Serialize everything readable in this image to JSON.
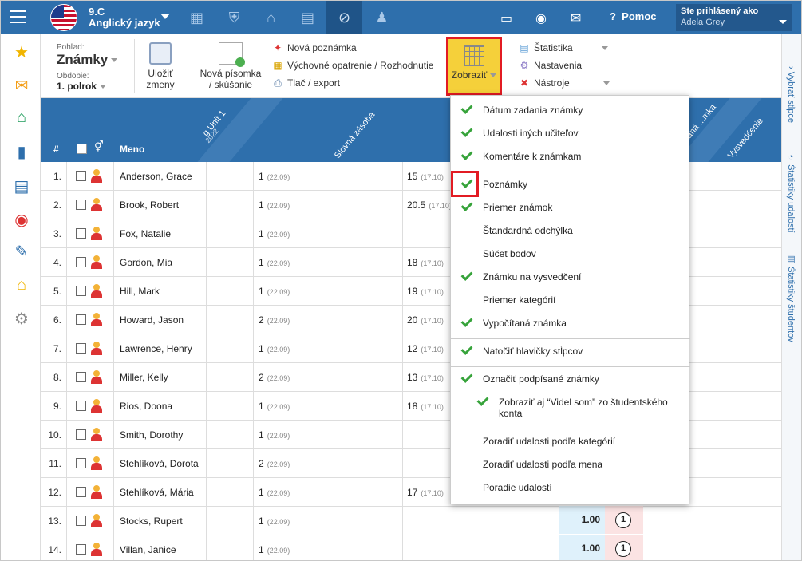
{
  "topbar": {
    "class_name": "9.C",
    "subject": "Anglický jazyk",
    "help": "Pomoc",
    "user_label": "Ste prihlásený ako",
    "user_name": "Adela Grey"
  },
  "toolbar": {
    "view_label": "Pohľad:",
    "view_value": "Známky",
    "period_label": "Obdobie:",
    "period_value": "1. polrok",
    "save_line1": "Uložiť",
    "save_line2": "zmeny",
    "new_test_line1": "Nová písomka",
    "new_test_line2": "/ skúšanie",
    "new_note": "Nová poznámka",
    "edu_measure": "Výchovné opatrenie / Rozhodnutie",
    "print": "Tlač / export",
    "display": "Zobraziť",
    "stats": "Štatistika",
    "settings": "Nastavenia",
    "tools": "Nástroje"
  },
  "right_sidebar": {
    "pick_columns": "Vybrať stĺpce",
    "event_stats": "Štatistiky udalostí",
    "student_stats": "Štatistiky študentov"
  },
  "table": {
    "col_num": "#",
    "col_name": "Meno",
    "header_unit": "g Unit 1",
    "header_year": "2022",
    "header_vocab": "Slovná zásoba",
    "header_calc": "...taná ...mka",
    "header_report": "Vysvedčenie",
    "rows": [
      {
        "n": "1.",
        "name": "Anderson, Grace",
        "g1": "1",
        "d1": "(22.09)",
        "g2": "15",
        "d2": "(17.10)"
      },
      {
        "n": "2.",
        "name": "Brook, Robert",
        "g1": "1",
        "d1": "(22.09)",
        "g2": "20.5",
        "d2": "(17.10)"
      },
      {
        "n": "3.",
        "name": "Fox, Natalie",
        "g1": "1",
        "d1": "(22.09)",
        "g2": "",
        "d2": ""
      },
      {
        "n": "4.",
        "name": "Gordon, Mia",
        "g1": "1",
        "d1": "(22.09)",
        "g2": "18",
        "d2": "(17.10)"
      },
      {
        "n": "5.",
        "name": "Hill, Mark",
        "g1": "1",
        "d1": "(22.09)",
        "g2": "19",
        "d2": "(17.10)"
      },
      {
        "n": "6.",
        "name": "Howard, Jason",
        "g1": "2",
        "d1": "(22.09)",
        "g2": "20",
        "d2": "(17.10)"
      },
      {
        "n": "7.",
        "name": "Lawrence, Henry",
        "g1": "1",
        "d1": "(22.09)",
        "g2": "12",
        "d2": "(17.10)"
      },
      {
        "n": "8.",
        "name": "Miller, Kelly",
        "g1": "2",
        "d1": "(22.09)",
        "g2": "13",
        "d2": "(17.10)"
      },
      {
        "n": "9.",
        "name": "Rios, Doona",
        "g1": "1",
        "d1": "(22.09)",
        "g2": "18",
        "d2": "(17.10)"
      },
      {
        "n": "10.",
        "name": "Smith, Dorothy",
        "g1": "1",
        "d1": "(22.09)",
        "g2": "",
        "d2": ""
      },
      {
        "n": "11.",
        "name": "Stehlíková, Dorota",
        "g1": "2",
        "d1": "(22.09)",
        "g2": "",
        "d2": ""
      },
      {
        "n": "12.",
        "name": "Stehlíková, Mária",
        "g1": "1",
        "d1": "(22.09)",
        "g2": "17",
        "d2": "(17.10)"
      },
      {
        "n": "13.",
        "name": "Stocks, Rupert",
        "g1": "1",
        "d1": "(22.09)",
        "g2": "",
        "d2": ""
      },
      {
        "n": "14.",
        "name": "Villan, Janice",
        "g1": "1",
        "d1": "(22.09)",
        "g2": "",
        "d2": ""
      }
    ],
    "avg_13": "1.00",
    "fin_13": "1",
    "avg_14": "1.00",
    "fin_14": "1"
  },
  "dropdown": {
    "items": [
      {
        "label": "Dátum zadania známky",
        "checked": true
      },
      {
        "label": "Udalosti iných učiteľov",
        "checked": true
      },
      {
        "label": "Komentáre k známkam",
        "checked": true
      },
      {
        "label": "Poznámky",
        "checked": true
      },
      {
        "label": "Priemer známok",
        "checked": true
      },
      {
        "label": "Štandardná odchýlka",
        "checked": false
      },
      {
        "label": "Súčet bodov",
        "checked": false
      },
      {
        "label": "Známku na vysvedčení",
        "checked": true
      },
      {
        "label": "Priemer kategórií",
        "checked": false
      },
      {
        "label": "Vypočítaná známka",
        "checked": true
      },
      {
        "label": "Natočiť hlavičky stĺpcov",
        "checked": true
      },
      {
        "label": "Označiť podpísané známky",
        "checked": true
      },
      {
        "label": "Zobraziť aj “Videl som” zo študentského",
        "checked": true
      },
      {
        "label": "konta",
        "checked": false
      },
      {
        "label": "Zoradiť udalosti podľa kategórií",
        "checked": false
      },
      {
        "label": "Zoradiť udalosti podľa mena",
        "checked": false
      },
      {
        "label": "Poradie udalostí",
        "checked": false
      }
    ]
  },
  "colors": {
    "primary": "#2e6fac",
    "accent_red": "#e21b23",
    "check_green": "#37a33b",
    "highlight_yellow": "#f5d03a"
  }
}
